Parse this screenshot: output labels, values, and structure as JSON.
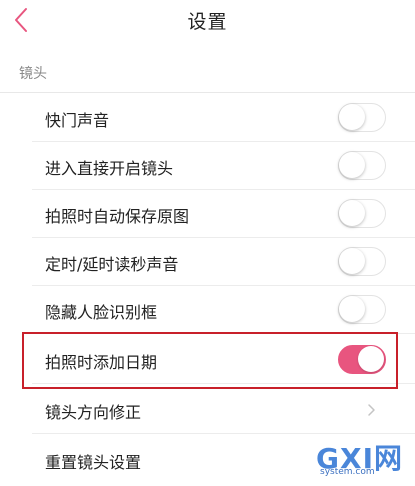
{
  "header": {
    "title": "设置",
    "back_icon": "chevron-left-icon"
  },
  "section": {
    "label": "镜头"
  },
  "rows": [
    {
      "label": "快门声音",
      "control": "toggle",
      "on": false
    },
    {
      "label": "进入直接开启镜头",
      "control": "toggle",
      "on": false
    },
    {
      "label": "拍照时自动保存原图",
      "control": "toggle",
      "on": false
    },
    {
      "label": "定时/延时读秒声音",
      "control": "toggle",
      "on": false
    },
    {
      "label": "隐藏人脸识别框",
      "control": "toggle",
      "on": false
    },
    {
      "label": "拍照时添加日期",
      "control": "toggle",
      "on": true
    },
    {
      "label": "镜头方向修正",
      "control": "chevron"
    },
    {
      "label": "重置镜头设置",
      "control": "none"
    }
  ],
  "colors": {
    "accent": "#e8557f",
    "highlight_border": "#c8202a"
  },
  "watermark": {
    "main": "GXI网",
    "sub": "system.com"
  }
}
